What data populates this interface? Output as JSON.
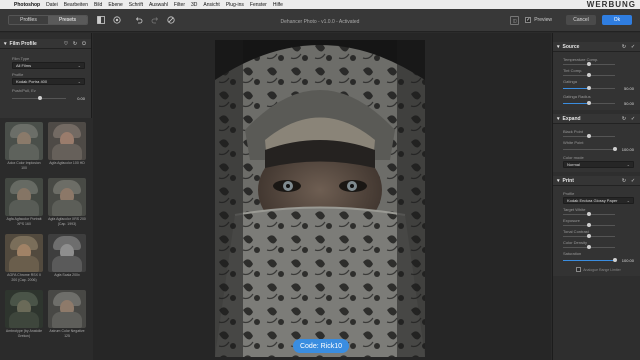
{
  "menubar": {
    "app_name": "Photoshop",
    "items": [
      "Datei",
      "Bearbeiten",
      "Bild",
      "Ebene",
      "Schrift",
      "Auswahl",
      "Filter",
      "3D",
      "Ansicht",
      "Plug-ins",
      "Fenster",
      "Hilfe"
    ],
    "brand": "WERBUNG"
  },
  "toolbar": {
    "tabs": [
      {
        "label": "Profiles"
      },
      {
        "label": "Presets"
      }
    ],
    "window_title": "Dehancer Photo - v1.0.0 - Activated",
    "preview_label": "Preview",
    "cancel_label": "Cancel",
    "ok_label": "Ok"
  },
  "film_profile": {
    "title": "Film Profile",
    "film_type_label": "Film Type",
    "film_type_value": "All Films",
    "profile_label": "Profile",
    "profile_value": "Kodak Portra 400",
    "push_pull_label": "Push/Pull, Ev",
    "push_pull_value": "0.00"
  },
  "presets": [
    {
      "label": "Adox Color Implosion 100"
    },
    {
      "label": "Agfa Agfacolor 100 HD"
    },
    {
      "label": "Agfa Agfacolor Portrait XPS 160"
    },
    {
      "label": "Agfa Agfacolor XRS 200 (Cap. 1993)"
    },
    {
      "label": "AGFA Chrome RSX II 200 (Cap. 2006)"
    },
    {
      "label": "Agfa Scala 200x"
    },
    {
      "label": "Ambrotype (by Anatolie Grekov)"
    },
    {
      "label": "Astrum Color Negative 125"
    }
  ],
  "code_badge": "Code: Rick10",
  "source": {
    "title": "Source",
    "temperature_label": "Temperature Comp.",
    "tint_label": "Tint Comp.",
    "gatinga_label": "Gatinga",
    "gatinga_value": "50.00",
    "gatinga_radius_label": "Gatinga Radius",
    "gatinga_radius_value": "50.00",
    "temperature_level": 0.5,
    "tint_level": 0.5,
    "gatinga_level": 0.5,
    "gatinga_radius_level": 0.5
  },
  "expand": {
    "title": "Expand",
    "black_point_label": "Black Point",
    "white_point_label": "White Point",
    "white_point_value": "100.00",
    "color_mode_label": "Color mode",
    "color_mode_value": "Normal",
    "black_point_level": 0.5,
    "white_point_level": 1.0
  },
  "print": {
    "title": "Print",
    "profile_label": "Profile",
    "profile_value": "Kodak Endura Glossy Paper",
    "target_white_label": "Target White",
    "exposure_label": "Exposure",
    "tonal_contrast_label": "Tonal Contrast",
    "color_density_label": "Color Density",
    "saturation_label": "Saturation",
    "saturation_value": "100.00",
    "analogue_label": "Analogue Range Limiter",
    "target_white_level": 0.5,
    "exposure_level": 0.5,
    "tonal_contrast_level": 0.5,
    "color_density_level": 0.5,
    "saturation_level": 1.0
  }
}
